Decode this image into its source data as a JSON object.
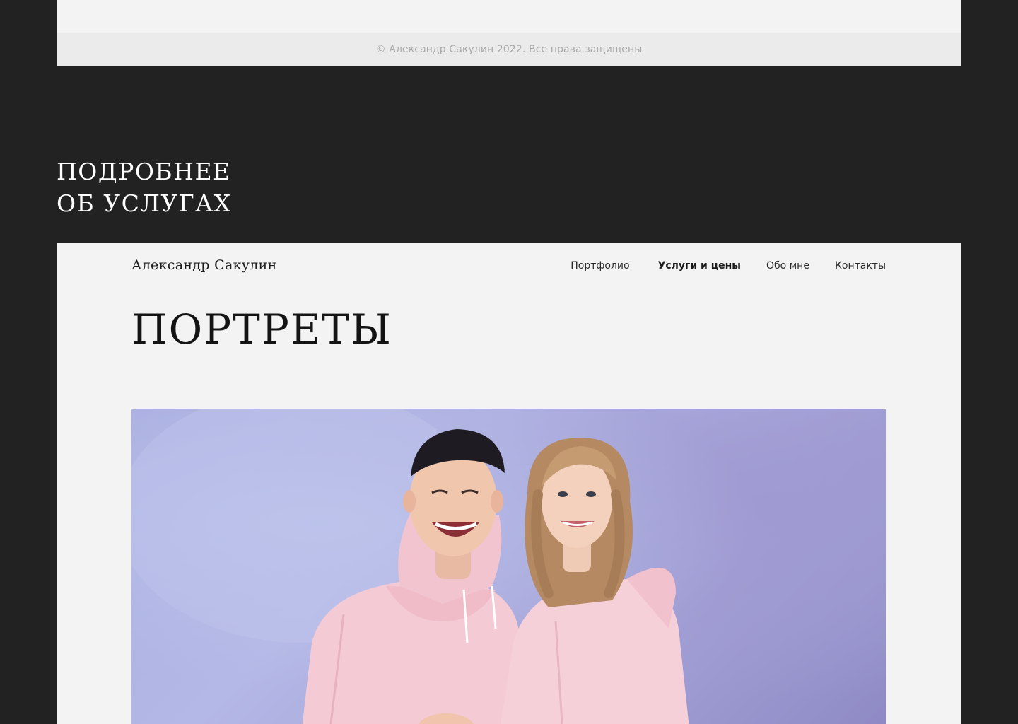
{
  "top_footer": {
    "copyright": "© Александр Сакулин 2022. Все права защищены"
  },
  "section_heading": {
    "line1": "Подробнее",
    "line2": "об услугах"
  },
  "header": {
    "logo": "Александр Сакулин",
    "nav": [
      {
        "label": "Портфолио",
        "active": false
      },
      {
        "label": "Услуги и цены",
        "active": true
      },
      {
        "label": "Обо мне",
        "active": false
      },
      {
        "label": "Контакты",
        "active": false
      }
    ]
  },
  "page": {
    "title": "Портреты"
  },
  "colors": {
    "outer_background": "#222222",
    "frame_background": "#f3f3f3",
    "footer_background": "#ebebeb",
    "photo_background": "#a9aedf",
    "hoodie_pink": "#f6cfd8"
  }
}
